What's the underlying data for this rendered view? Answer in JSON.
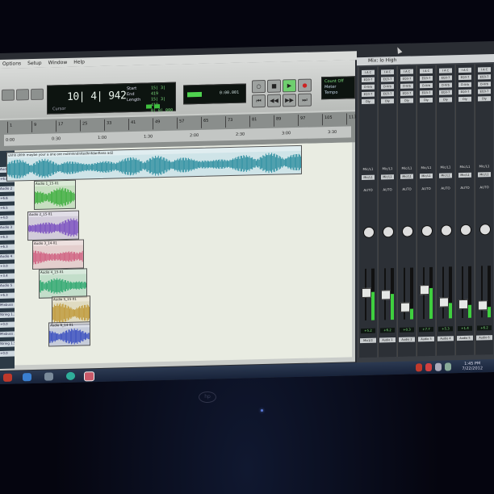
{
  "menu": [
    "Options",
    "Setup",
    "Window",
    "Help"
  ],
  "counter": {
    "main": "10| 4| 942",
    "cursor_label": "Cursor",
    "start_label": "Start",
    "end_label": "End",
    "length_label": "Length",
    "start_val": "15| 3| 419",
    "end_val": "15| 3| 419",
    "length_val": "0| 0| 000"
  },
  "nudge_value": "0:00.001",
  "count_off": {
    "line1": "Count Off",
    "line2": "Meter",
    "line3": "Tempo"
  },
  "bar_numbers": [
    "1",
    "9",
    "17",
    "25",
    "33",
    "41",
    "49",
    "57",
    "65",
    "73",
    "81",
    "89",
    "97",
    "105",
    "113"
  ],
  "time_marks": [
    "0:00",
    "0:30",
    "1:00",
    "1:30",
    "2:00",
    "2:30",
    "3:00",
    "3:30"
  ],
  "regions": [
    {
      "name": "uhhh ohhh maybe your a one ore mdrmkndnitedhnfdanfiana ad2",
      "color": "#2f8fa0"
    },
    {
      "name": "Audio 1_15-01",
      "color": "#3fae3f"
    },
    {
      "name": "Audio 2_15-01",
      "color": "#7a4fc0"
    },
    {
      "name": "Audio 3_14-01",
      "color": "#d06080"
    },
    {
      "name": "Audio 4_15-01",
      "color": "#2fa870"
    },
    {
      "name": "Audio 5_15-01",
      "color": "#c09a3a"
    },
    {
      "name": "Audio 6_14-01",
      "color": "#3a4fc0"
    }
  ],
  "tracklist_labels": [
    "Audio 1",
    "+6.8",
    "Audio 2",
    "+6.6",
    "+6.5",
    "+4.0",
    "Audio 3",
    "+6.3",
    "+6.3",
    "Audio 4",
    "+3.0",
    "+3.4",
    "Audio 5",
    "+6.3",
    "Mixbuss 1",
    "String 1.3",
    "+0.0",
    "Mixbuss 2",
    "String 1.5",
    "+0.0"
  ],
  "mix_window_title": "Mix: lo High",
  "strips": [
    {
      "io": "Mic/L1",
      "vol": "+5.2",
      "name": "Mix1/2",
      "level": 0.55
    },
    {
      "io": "Mic/L1",
      "vol": "+6.2",
      "name": "Audio 1",
      "level": 0.5
    },
    {
      "io": "Mic/L1",
      "vol": "+0.3",
      "name": "Audio 2",
      "level": 0.2
    },
    {
      "io": "Mic/L1",
      "vol": "+7.7",
      "name": "Audio 3",
      "level": 0.6
    },
    {
      "io": "Mic/L1",
      "vol": "+5.3",
      "name": "Audio 4",
      "level": 0.3
    },
    {
      "io": "Mic/L1",
      "vol": "+1.4",
      "name": "Audio 5",
      "level": 0.25
    },
    {
      "io": "Mic/L1",
      "vol": "+6.2",
      "name": "Audio 6",
      "level": 0.2
    }
  ],
  "insert_labels": [
    "I A C",
    "EQ3-7",
    "D-Vrb",
    "EQ3-7",
    "Dly"
  ],
  "auto_label": "AUTO",
  "clock": {
    "time": "1:45 PM",
    "date": "7/22/2012"
  },
  "bezel_logo": "hp"
}
